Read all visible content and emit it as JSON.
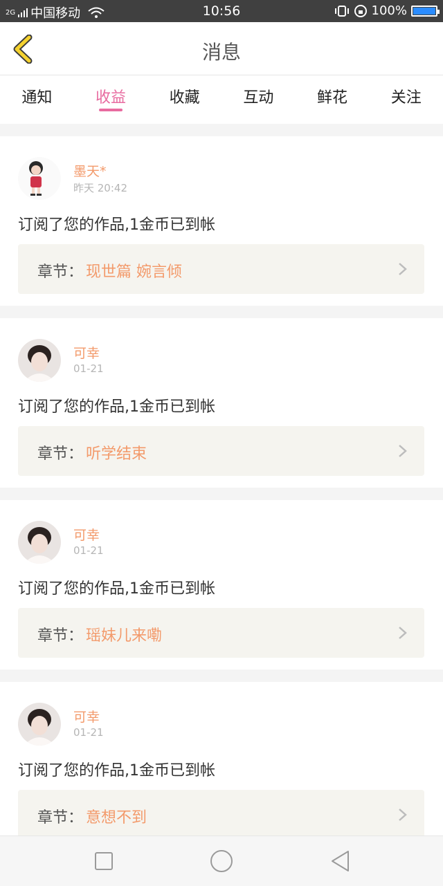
{
  "status_bar": {
    "network": "2G",
    "carrier": "中国移动",
    "time": "10:56",
    "battery": "100%"
  },
  "header": {
    "title": "消息"
  },
  "tabs": [
    {
      "label": "通知"
    },
    {
      "label": "收益"
    },
    {
      "label": "收藏"
    },
    {
      "label": "互动"
    },
    {
      "label": "鲜花"
    },
    {
      "label": "关注"
    }
  ],
  "active_tab": "收益",
  "chapter_prefix": "章节：",
  "messages": [
    {
      "user": "墨天*",
      "time": "昨天 20:42",
      "text": "订阅了您的作品,1金币已到帐",
      "chapter": "现世篇 婉言倾"
    },
    {
      "user": "可幸",
      "time": "01-21",
      "text": "订阅了您的作品,1金币已到帐",
      "chapter": "听学结束"
    },
    {
      "user": "可幸",
      "time": "01-21",
      "text": "订阅了您的作品,1金币已到帐",
      "chapter": "瑶妹儿来嘞"
    },
    {
      "user": "可幸",
      "time": "01-21",
      "text": "订阅了您的作品,1金币已到帐",
      "chapter": "意想不到"
    }
  ],
  "colors": {
    "accent_pink": "#e86ba0",
    "accent_orange": "#f39a6b",
    "back_arrow": "#f5d22f"
  },
  "icons": [
    "back-arrow-icon",
    "chevron-right-icon",
    "square-icon",
    "circle-icon",
    "triangle-back-icon",
    "wifi-icon",
    "battery-icon"
  ]
}
